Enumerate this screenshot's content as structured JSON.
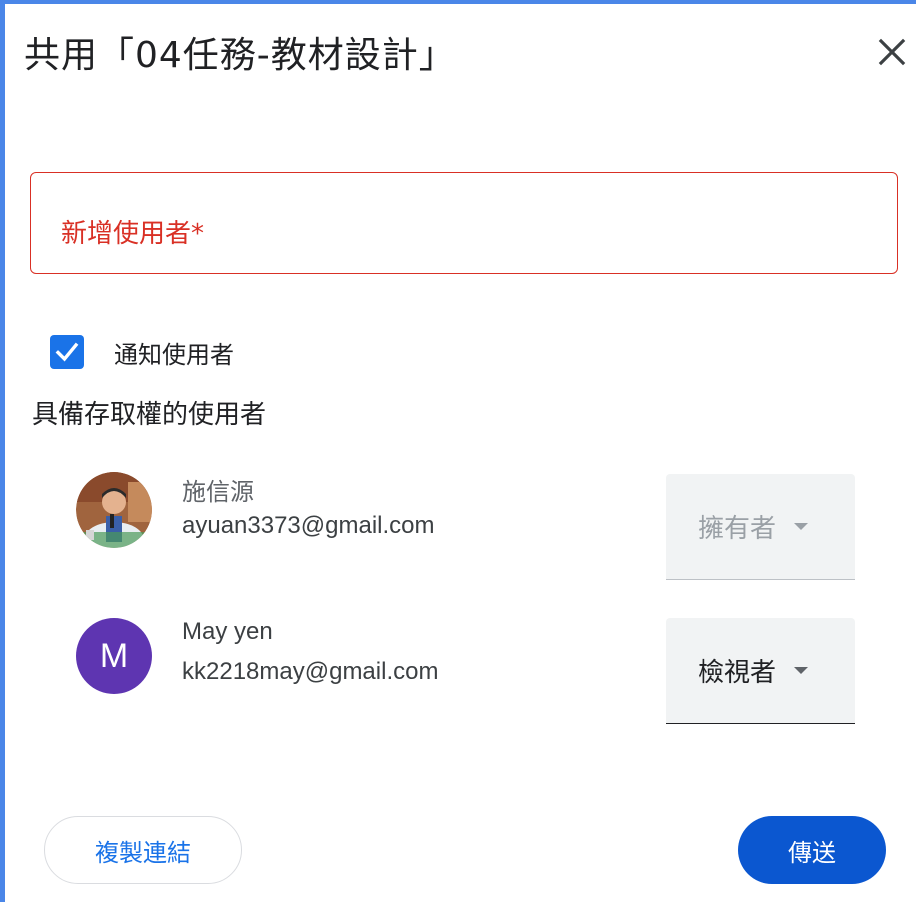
{
  "dialog": {
    "title": "共用「04任務-教材設計」",
    "close_icon": "close-icon"
  },
  "add_user_field": {
    "label": "新增使用者*",
    "value": ""
  },
  "notify": {
    "checked": true,
    "label": "通知使用者"
  },
  "access_section": {
    "label": "具備存取權的使用者",
    "users": [
      {
        "name": "施信源",
        "email": "ayuan3373@gmail.com",
        "avatar": "photo",
        "role": "擁有者",
        "role_editable": false
      },
      {
        "name": "May yen",
        "email": "kk2218may@gmail.com",
        "avatar_letter": "M",
        "avatar_color": "#5e35b1",
        "role": "檢視者",
        "role_editable": true
      }
    ]
  },
  "actions": {
    "copy_link_label": "複製連結",
    "send_label": "傳送"
  },
  "colors": {
    "accent": "#1a73e8",
    "send_button": "#0b57d0",
    "error": "#d93025",
    "frame": "#4a86e8"
  }
}
